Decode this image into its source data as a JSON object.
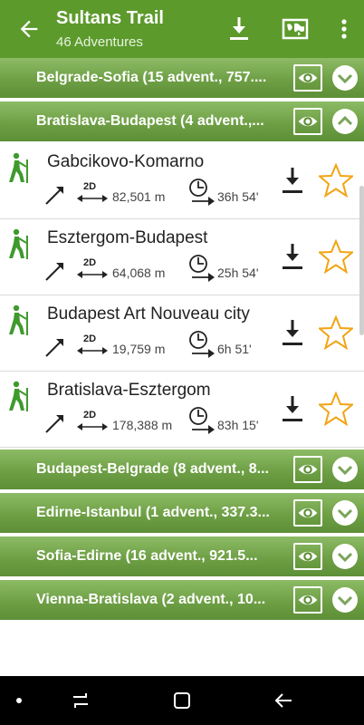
{
  "appbar": {
    "title": "Sultans Trail",
    "subtitle": "46 Adventures",
    "accent": "#5c9a2c",
    "icons": [
      "back-arrow-icon",
      "download-icon",
      "map-icon",
      "overflow-menu-icon"
    ]
  },
  "groups_top": [
    {
      "title": "Belgrade-Sofia (15 advent., 757....",
      "expanded": false
    },
    {
      "title": "Bratislava-Budapest (4 advent.,...",
      "expanded": true
    }
  ],
  "adventures": [
    {
      "name": "Gabcikovo-Komarno",
      "dim_label": "2D",
      "distance": "82,501 m",
      "duration": "36h 54'"
    },
    {
      "name": "Esztergom-Budapest",
      "dim_label": "2D",
      "distance": "64,068 m",
      "duration": "25h 54'"
    },
    {
      "name": "Budapest Art Nouveau city",
      "dim_label": "2D",
      "distance": "19,759 m",
      "duration": "6h 51'"
    },
    {
      "name": "Bratislava-Esztergom",
      "dim_label": "2D",
      "distance": "178,388 m",
      "duration": "83h 15'"
    }
  ],
  "groups_bottom": [
    {
      "title": "Budapest-Belgrade (8 advent., 8...",
      "expanded": false
    },
    {
      "title": "Edirne-Istanbul (1 advent., 337.3...",
      "expanded": false
    },
    {
      "title": "Sofia-Edirne (16 advent., 921.5...",
      "expanded": false
    },
    {
      "title": "Vienna-Bratislava (2 advent., 10...",
      "expanded": false
    }
  ],
  "colors": {
    "group_bg": "#6e9f45",
    "hiker": "#3f9a2e",
    "star": "#f2a413"
  }
}
